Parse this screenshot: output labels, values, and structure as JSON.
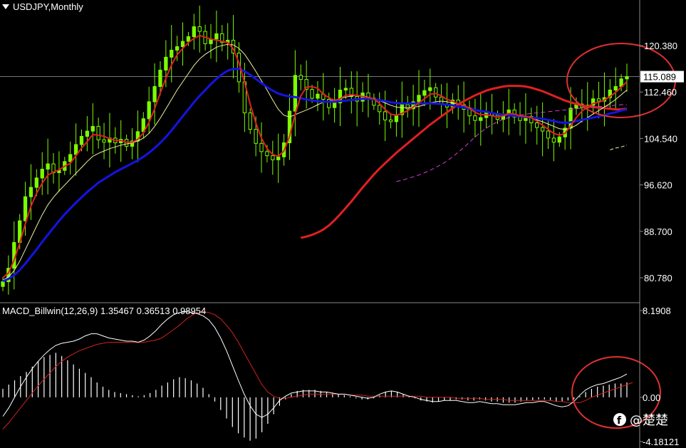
{
  "chart_data": [
    {
      "type": "candlestick",
      "title": "USDJPY,Monthly",
      "current_price": 115.089,
      "current_price_label": "115.089",
      "yticks": [
        120.38,
        112.46,
        104.54,
        96.62,
        88.7,
        80.78
      ],
      "ytick_labels": [
        "120.380",
        "112.460",
        "104.540",
        "96.620",
        "88.700",
        "80.780"
      ],
      "close": [
        80.1,
        82.4,
        86.8,
        90.5,
        94.6,
        96.2,
        97.8,
        99.3,
        100.2,
        98.7,
        99.1,
        100.6,
        101.8,
        103.5,
        104.9,
        105.8,
        106.6,
        104.3,
        103.9,
        104.6,
        103.8,
        104.4,
        103.2,
        104.1,
        105.7,
        107.9,
        110.8,
        113.4,
        116.2,
        118.4,
        119.6,
        120.2,
        121.1,
        121.9,
        123.6,
        122.8,
        120.7,
        121.5,
        122.4,
        120.9,
        121.3,
        119.1,
        114.2,
        108.9,
        106.1,
        103.7,
        102.3,
        101.6,
        100.9,
        101.4,
        103.8,
        109.2,
        115.3,
        114.6,
        112.9,
        111.4,
        112.1,
        111.2,
        109.8,
        110.6,
        112.8,
        113.1,
        111.7,
        110.9,
        112.3,
        111.4,
        110.2,
        109.1,
        107.7,
        107.4,
        108.6,
        110.3,
        109.6,
        110.8,
        111.9,
        112.7,
        113.2,
        111.6,
        110.4,
        109.9,
        111.1,
        110.3,
        109.5,
        108.4,
        107.6,
        108.1,
        108.9,
        108.5,
        107.8,
        108.7,
        109.4,
        108.2,
        107.6,
        108.3,
        107.2,
        106.4,
        105.8,
        104.6,
        103.9,
        104.8,
        106.3,
        109.7,
        110.4,
        109.8,
        110.2,
        111.3,
        110.9,
        111.5,
        112.8,
        113.4,
        114.7,
        115.1
      ],
      "ma_red_thin": [
        80.8,
        81.6,
        83.8,
        86.7,
        90.0,
        93.0,
        95.2,
        96.9,
        98.3,
        98.8,
        99.2,
        99.8,
        100.3,
        101.6,
        102.9,
        104.0,
        105.2,
        105.1,
        104.9,
        104.5,
        104.2,
        104.2,
        103.9,
        103.9,
        104.4,
        105.5,
        107.3,
        109.6,
        112.3,
        114.8,
        117.1,
        118.8,
        119.9,
        120.9,
        121.6,
        122.1,
        121.8,
        121.5,
        121.3,
        121.1,
        120.9,
        119.8,
        117.4,
        114.1,
        110.4,
        107.2,
        104.6,
        102.8,
        101.8,
        101.5,
        102.4,
        104.9,
        108.7,
        111.8,
        113.3,
        113.4,
        113.1,
        112.1,
        111.5,
        111.0,
        111.3,
        111.9,
        112.0,
        111.9,
        111.7,
        111.5,
        111.3,
        110.5,
        109.5,
        108.7,
        108.5,
        108.8,
        109.3,
        109.9,
        110.6,
        111.3,
        112.1,
        112.2,
        111.8,
        111.2,
        110.9,
        110.4,
        110.2,
        109.7,
        109.0,
        108.6,
        108.6,
        108.4,
        108.2,
        108.4,
        108.8,
        108.7,
        108.4,
        108.3,
        108.1,
        107.5,
        106.8,
        106.1,
        105.4,
        105.1,
        105.4,
        106.7,
        108.1,
        109.2,
        109.9,
        110.5,
        110.7,
        111.1,
        111.7,
        112.4,
        113.3,
        114.2
      ],
      "ma_yellow_thin": [
        80.4,
        80.9,
        82.0,
        83.6,
        85.6,
        87.6,
        89.6,
        91.5,
        93.2,
        94.5,
        95.6,
        96.6,
        97.6,
        98.6,
        99.6,
        100.6,
        101.5,
        102.0,
        102.4,
        102.8,
        103.1,
        103.4,
        103.6,
        103.8,
        104.1,
        104.6,
        105.4,
        106.6,
        108.0,
        109.6,
        111.2,
        112.8,
        114.2,
        115.6,
        117.0,
        118.1,
        118.9,
        119.5,
        120.1,
        120.4,
        120.6,
        120.5,
        119.9,
        118.9,
        117.5,
        116.0,
        114.4,
        112.8,
        111.1,
        109.5,
        108.5,
        108.2,
        108.6,
        109.0,
        109.4,
        109.8,
        110.3,
        110.7,
        110.9,
        111.1,
        111.3,
        111.6,
        111.8,
        111.9,
        111.8,
        111.6,
        111.3,
        111.0,
        110.6,
        110.2,
        109.9,
        109.8,
        109.8,
        109.9,
        110.0,
        110.3,
        110.6,
        110.8,
        110.9,
        110.8,
        110.6,
        110.4,
        110.1,
        109.8,
        109.5,
        109.2,
        109.0,
        108.8,
        108.6,
        108.5,
        108.4,
        108.3,
        108.2,
        108.1,
        108.0,
        107.7,
        107.4,
        107.0,
        106.6,
        106.2,
        106.1,
        106.3,
        106.8,
        107.5,
        108.1,
        108.7,
        109.3,
        109.9,
        110.5,
        111.2,
        112.0,
        112.8
      ],
      "ma_blue": [
        80.2,
        80.6,
        81.2,
        82.1,
        83.2,
        84.4,
        85.6,
        86.9,
        88.1,
        89.3,
        90.5,
        91.6,
        92.6,
        93.6,
        94.5,
        95.4,
        96.2,
        97.0,
        97.6,
        98.2,
        98.8,
        99.3,
        99.8,
        100.3,
        100.8,
        101.4,
        102.1,
        102.9,
        103.8,
        104.8,
        105.9,
        107.1,
        108.3,
        109.5,
        110.7,
        111.8,
        112.8,
        113.8,
        114.7,
        115.5,
        116.1,
        116.4,
        116.4,
        116.0,
        115.4,
        114.7,
        114.0,
        113.3,
        112.7,
        112.2,
        111.9,
        111.7,
        111.6,
        111.4,
        111.2,
        111.0,
        110.9,
        110.8,
        110.8,
        110.8,
        110.9,
        111.0,
        111.1,
        111.2,
        111.3,
        111.3,
        111.2,
        111.1,
        110.9,
        110.7,
        110.6,
        110.5,
        110.5,
        110.5,
        110.5,
        110.5,
        110.5,
        110.5,
        110.4,
        110.3,
        110.2,
        110.0,
        109.8,
        109.6,
        109.4,
        109.2,
        109.1,
        108.9,
        108.7,
        108.6,
        108.5,
        108.4,
        108.3,
        108.2,
        108.1,
        108.0,
        107.9,
        107.7,
        107.5,
        107.3,
        107.2,
        107.3,
        107.5,
        107.7,
        107.9,
        108.1,
        108.3,
        108.5,
        108.8,
        109.0,
        109.3,
        109.5
      ],
      "ma_red_thick": [
        87.6,
        87.8,
        88.1,
        88.5,
        89.0,
        89.7,
        90.6,
        91.6,
        92.7,
        93.8,
        95.0,
        96.2,
        97.3,
        98.4,
        99.4,
        100.3,
        101.2,
        102.1,
        102.9,
        103.7,
        104.5,
        105.3,
        106.1,
        106.9,
        107.6,
        108.3,
        109.0,
        109.7,
        110.3,
        110.9,
        111.4,
        111.9,
        112.3,
        112.7,
        113.0,
        113.2,
        113.4,
        113.5,
        113.5,
        113.5,
        113.4,
        113.2,
        112.9,
        112.6,
        112.2,
        111.8,
        111.4,
        111.0,
        110.7,
        110.4,
        110.2,
        110.0,
        109.9,
        109.8,
        109.7,
        109.6,
        109.5,
        109.5,
        109.6
      ],
      "ma_magenta_dashed": [
        97.2,
        97.4,
        97.7,
        98.0,
        98.3,
        98.7,
        99.1,
        99.6,
        100.1,
        100.7,
        101.4,
        102.2,
        103.0,
        103.9,
        104.8,
        105.6,
        106.3,
        106.9,
        107.4,
        107.8,
        108.1,
        108.3,
        108.5,
        108.7,
        108.8,
        108.9,
        109.0,
        109.1,
        109.2,
        109.3,
        109.4,
        109.5,
        109.6,
        109.7,
        109.8,
        109.9,
        110.0,
        110.0,
        110.1,
        110.2,
        110.3,
        110.3
      ],
      "ma_yellow_dashed_tail": [
        102.6,
        102.9,
        103.1,
        103.4
      ]
    },
    {
      "type": "macd",
      "title": "MACD_Billwin(12,26,9) 1.35467 0.36513 0.98954",
      "yticks": [
        8.1908,
        0.0,
        -4.18121
      ],
      "ytick_labels": [
        "8.1908",
        "0.00",
        "-4.18121"
      ],
      "histogram": [
        0.8,
        1.2,
        1.6,
        2.0,
        2.4,
        2.9,
        3.4,
        3.8,
        4.0,
        4.2,
        3.9,
        3.5,
        3.1,
        2.7,
        2.3,
        1.9,
        1.4,
        1.0,
        0.7,
        0.5,
        0.4,
        0.3,
        0.2,
        0.1,
        0.2,
        0.4,
        0.7,
        1.1,
        1.4,
        1.7,
        1.9,
        1.8,
        1.6,
        1.3,
        0.9,
        0.3,
        -0.4,
        -1.2,
        -2.0,
        -2.8,
        -3.4,
        -3.8,
        -4.1,
        -3.9,
        -3.3,
        -2.5,
        -1.6,
        -0.8,
        -0.2,
        0.3,
        0.6,
        0.7,
        0.7,
        0.7,
        0.6,
        0.5,
        0.4,
        0.3,
        0.2,
        0.1,
        -0.1,
        -0.2,
        -0.2,
        -0.1,
        0.2,
        0.5,
        0.6,
        0.5,
        0.3,
        0.1,
        -0.1,
        -0.3,
        -0.4,
        -0.5,
        -0.4,
        -0.3,
        -0.3,
        -0.2,
        -0.2,
        -0.3,
        -0.3,
        -0.2,
        -0.3,
        -0.4,
        -0.4,
        -0.5,
        -0.5,
        -0.5,
        -0.4,
        -0.3,
        -0.3,
        -0.2,
        -0.2,
        -0.3,
        -0.4,
        -0.4,
        -0.3,
        -0.2,
        0.1,
        0.5,
        0.8,
        1.0,
        1.1,
        1.2,
        1.3,
        1.3,
        1.4
      ],
      "macd_line": [
        -1.8,
        -1.0,
        0.0,
        1.0,
        1.9,
        2.7,
        3.4,
        4.0,
        4.5,
        4.9,
        5.1,
        5.2,
        5.3,
        5.5,
        5.8,
        6.0,
        6.0,
        5.8,
        5.6,
        5.5,
        5.4,
        5.3,
        5.3,
        5.2,
        5.4,
        5.8,
        6.3,
        6.9,
        7.4,
        7.8,
        8.0,
        8.1,
        8.0,
        7.9,
        7.7,
        7.3,
        6.6,
        5.6,
        4.4,
        3.0,
        1.6,
        0.3,
        -0.8,
        -1.6,
        -1.9,
        -1.6,
        -1.0,
        -0.3,
        0.1,
        0.4,
        0.5,
        0.6,
        0.6,
        0.6,
        0.5,
        0.5,
        0.4,
        0.3,
        0.3,
        0.2,
        0.1,
        0.0,
        -0.1,
        0.0,
        0.3,
        0.5,
        0.6,
        0.5,
        0.3,
        0.1,
        0.0,
        -0.2,
        -0.3,
        -0.4,
        -0.4,
        -0.3,
        -0.3,
        -0.3,
        -0.4,
        -0.5,
        -0.5,
        -0.4,
        -0.5,
        -0.6,
        -0.6,
        -0.7,
        -0.7,
        -0.7,
        -0.6,
        -0.5,
        -0.5,
        -0.4,
        -0.4,
        -0.6,
        -0.8,
        -0.9,
        -0.8,
        -0.4,
        0.2,
        0.7,
        1.0,
        1.2,
        1.3,
        1.5,
        1.7,
        1.9,
        2.2
      ],
      "signal_line": [
        -3.0,
        -2.4,
        -1.7,
        -1.0,
        -0.3,
        0.4,
        1.1,
        1.7,
        2.3,
        2.9,
        3.4,
        3.8,
        4.1,
        4.4,
        4.6,
        4.8,
        5.0,
        5.1,
        5.2,
        5.2,
        5.2,
        5.2,
        5.2,
        5.2,
        5.2,
        5.3,
        5.4,
        5.6,
        6.0,
        6.4,
        6.8,
        7.3,
        7.7,
        8.0,
        8.1,
        8.0,
        7.8,
        7.4,
        6.8,
        6.1,
        5.2,
        4.2,
        3.2,
        2.2,
        1.2,
        0.5,
        0.1,
        -0.1,
        -0.1,
        0.0,
        0.1,
        0.2,
        0.3,
        0.3,
        0.3,
        0.3,
        0.3,
        0.3,
        0.3,
        0.2,
        0.2,
        0.2,
        0.1,
        0.1,
        0.1,
        0.1,
        0.1,
        0.1,
        0.1,
        0.1,
        0.1,
        0.1,
        0.0,
        0.0,
        0.0,
        0.0,
        0.0,
        -0.1,
        -0.1,
        -0.1,
        -0.1,
        -0.1,
        -0.2,
        -0.2,
        -0.2,
        -0.2,
        -0.3,
        -0.3,
        -0.3,
        -0.3,
        -0.3,
        -0.3,
        -0.3,
        -0.3,
        -0.4,
        -0.4,
        -0.5,
        -0.5,
        -0.5,
        -0.3,
        0.0,
        0.2,
        0.4,
        0.6,
        0.8,
        1.0,
        1.2,
        1.4
      ]
    }
  ],
  "watermark": {
    "icon": "facebook-icon",
    "text": "@楚楚"
  },
  "colors": {
    "background": "#000000",
    "up_candle": "#7CFC00",
    "down_candle": "#000000",
    "ma_red": "#e02020",
    "ma_blue": "#1414e0",
    "ma_yellow": "#f0f0a0",
    "magenta": "#d040d0",
    "annotation_circle": "#e03030",
    "macd_line": "#ffffff",
    "signal_line": "#d02020"
  }
}
